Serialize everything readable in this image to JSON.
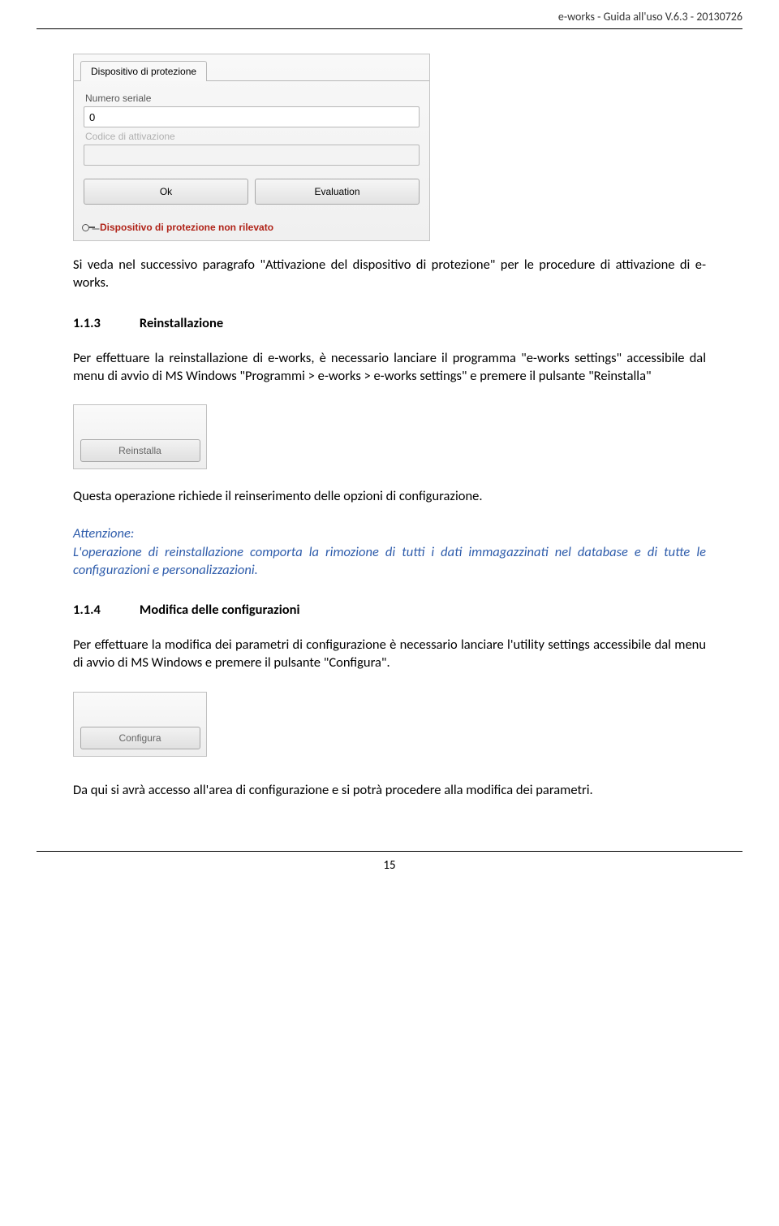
{
  "header": {
    "text": "e-works - Guida  all'uso V.6.3 - 20130726"
  },
  "dialog1": {
    "tab": "Dispositivo di protezione",
    "label_serial": "Numero seriale",
    "value_serial": "0",
    "label_code": "Codice di attivazione",
    "value_code": "",
    "btn_ok": "Ok",
    "btn_eval": "Evaluation",
    "footer_msg": "Dispositivo di protezione non rilevato"
  },
  "para1": "Si veda nel successivo paragrafo \"Attivazione del dispositivo di protezione\" per le procedure di attivazione di e-works.",
  "section113": {
    "num": "1.1.3",
    "title": "Reinstallazione"
  },
  "para2": "Per effettuare la reinstallazione di e-works, è necessario lanciare il programma \"e-works settings\" accessibile dal menu di avvio di MS Windows  \"Programmi > e-works > e-works settings\" e premere il pulsante \"Reinstalla\"",
  "btn_reinstalla": "Reinstalla",
  "para3": "Questa operazione richiede il reinserimento delle opzioni di configurazione.",
  "attention": {
    "label": "Attenzione:",
    "body": "L'operazione di reinstallazione comporta la rimozione di tutti i dati immagazzinati nel database e di tutte le configurazioni e personalizzazioni."
  },
  "section114": {
    "num": "1.1.4",
    "title": "Modifica delle configurazioni"
  },
  "para4": "Per effettuare la modifica dei parametri di configurazione è necessario lanciare l'utility settings accessibile dal menu di avvio di MS Windows  e premere il pulsante \"Configura\".",
  "btn_configura": "Configura",
  "para5": "Da qui si avrà accesso all'area di configurazione e si potrà procedere alla modifica dei parametri.",
  "page_number": "15"
}
